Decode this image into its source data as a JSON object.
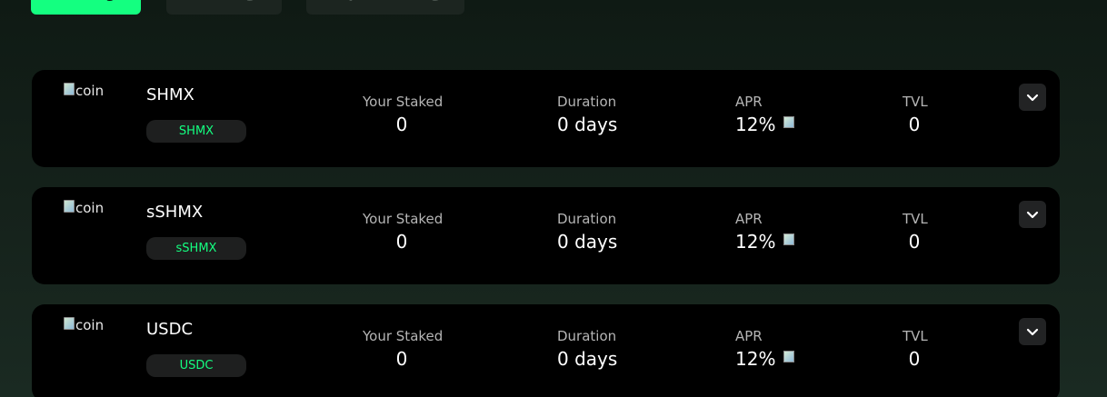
{
  "tabs": [
    {
      "label": "Staking"
    },
    {
      "label": "Farming"
    },
    {
      "label": "Liquid Staking"
    }
  ],
  "colors": {
    "accent": "#14ff80",
    "card_bg": "#000000",
    "badge_bg": "#1e1f1f",
    "label_text": "#b5b5b5"
  },
  "pools": [
    {
      "coin_alt": "coin",
      "name": "SHMX",
      "badge": "SHMX",
      "staked_label": "Your Staked",
      "staked_value": "0",
      "duration_label": "Duration",
      "duration_value": "0 days",
      "apr_label": "APR",
      "apr_value": "12%",
      "tvl_label": "TVL",
      "tvl_value": "0",
      "expand_icon": "chevron-down-icon"
    },
    {
      "coin_alt": "coin",
      "name": "sSHMX",
      "badge": "sSHMX",
      "staked_label": "Your Staked",
      "staked_value": "0",
      "duration_label": "Duration",
      "duration_value": "0 days",
      "apr_label": "APR",
      "apr_value": "12%",
      "tvl_label": "TVL",
      "tvl_value": "0",
      "expand_icon": "chevron-down-icon"
    },
    {
      "coin_alt": "coin",
      "name": "USDC",
      "badge": "USDC",
      "staked_label": "Your Staked",
      "staked_value": "0",
      "duration_label": "Duration",
      "duration_value": "0 days",
      "apr_label": "APR",
      "apr_value": "12%",
      "tvl_label": "TVL",
      "tvl_value": "0",
      "expand_icon": "chevron-down-icon"
    }
  ]
}
